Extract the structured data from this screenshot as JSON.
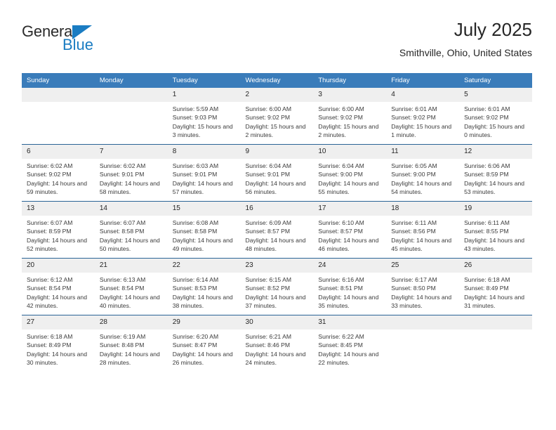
{
  "logo": {
    "word_top": "General",
    "word_bottom": "Blue",
    "triangle_color": "#1a7cc2",
    "top_color": "#2b2b2b"
  },
  "header": {
    "title": "July 2025",
    "subtitle": "Smithville, Ohio, United States"
  },
  "theme": {
    "header_blue": "#3a7cba",
    "row_divider": "#2a6496",
    "daynum_band": "#efefef"
  },
  "calendar": {
    "weekday_headers": [
      "Sunday",
      "Monday",
      "Tuesday",
      "Wednesday",
      "Thursday",
      "Friday",
      "Saturday"
    ],
    "weeks": [
      [
        {
          "day": "",
          "empty": true,
          "sunrise": "",
          "sunset": "",
          "daylight": ""
        },
        {
          "day": "",
          "empty": true,
          "sunrise": "",
          "sunset": "",
          "daylight": ""
        },
        {
          "day": "1",
          "sunrise": "Sunrise: 5:59 AM",
          "sunset": "Sunset: 9:03 PM",
          "daylight": "Daylight: 15 hours and 3 minutes."
        },
        {
          "day": "2",
          "sunrise": "Sunrise: 6:00 AM",
          "sunset": "Sunset: 9:02 PM",
          "daylight": "Daylight: 15 hours and 2 minutes."
        },
        {
          "day": "3",
          "sunrise": "Sunrise: 6:00 AM",
          "sunset": "Sunset: 9:02 PM",
          "daylight": "Daylight: 15 hours and 2 minutes."
        },
        {
          "day": "4",
          "sunrise": "Sunrise: 6:01 AM",
          "sunset": "Sunset: 9:02 PM",
          "daylight": "Daylight: 15 hours and 1 minute."
        },
        {
          "day": "5",
          "sunrise": "Sunrise: 6:01 AM",
          "sunset": "Sunset: 9:02 PM",
          "daylight": "Daylight: 15 hours and 0 minutes."
        }
      ],
      [
        {
          "day": "6",
          "sunrise": "Sunrise: 6:02 AM",
          "sunset": "Sunset: 9:02 PM",
          "daylight": "Daylight: 14 hours and 59 minutes."
        },
        {
          "day": "7",
          "sunrise": "Sunrise: 6:02 AM",
          "sunset": "Sunset: 9:01 PM",
          "daylight": "Daylight: 14 hours and 58 minutes."
        },
        {
          "day": "8",
          "sunrise": "Sunrise: 6:03 AM",
          "sunset": "Sunset: 9:01 PM",
          "daylight": "Daylight: 14 hours and 57 minutes."
        },
        {
          "day": "9",
          "sunrise": "Sunrise: 6:04 AM",
          "sunset": "Sunset: 9:01 PM",
          "daylight": "Daylight: 14 hours and 56 minutes."
        },
        {
          "day": "10",
          "sunrise": "Sunrise: 6:04 AM",
          "sunset": "Sunset: 9:00 PM",
          "daylight": "Daylight: 14 hours and 55 minutes."
        },
        {
          "day": "11",
          "sunrise": "Sunrise: 6:05 AM",
          "sunset": "Sunset: 9:00 PM",
          "daylight": "Daylight: 14 hours and 54 minutes."
        },
        {
          "day": "12",
          "sunrise": "Sunrise: 6:06 AM",
          "sunset": "Sunset: 8:59 PM",
          "daylight": "Daylight: 14 hours and 53 minutes."
        }
      ],
      [
        {
          "day": "13",
          "sunrise": "Sunrise: 6:07 AM",
          "sunset": "Sunset: 8:59 PM",
          "daylight": "Daylight: 14 hours and 52 minutes."
        },
        {
          "day": "14",
          "sunrise": "Sunrise: 6:07 AM",
          "sunset": "Sunset: 8:58 PM",
          "daylight": "Daylight: 14 hours and 50 minutes."
        },
        {
          "day": "15",
          "sunrise": "Sunrise: 6:08 AM",
          "sunset": "Sunset: 8:58 PM",
          "daylight": "Daylight: 14 hours and 49 minutes."
        },
        {
          "day": "16",
          "sunrise": "Sunrise: 6:09 AM",
          "sunset": "Sunset: 8:57 PM",
          "daylight": "Daylight: 14 hours and 48 minutes."
        },
        {
          "day": "17",
          "sunrise": "Sunrise: 6:10 AM",
          "sunset": "Sunset: 8:57 PM",
          "daylight": "Daylight: 14 hours and 46 minutes."
        },
        {
          "day": "18",
          "sunrise": "Sunrise: 6:11 AM",
          "sunset": "Sunset: 8:56 PM",
          "daylight": "Daylight: 14 hours and 45 minutes."
        },
        {
          "day": "19",
          "sunrise": "Sunrise: 6:11 AM",
          "sunset": "Sunset: 8:55 PM",
          "daylight": "Daylight: 14 hours and 43 minutes."
        }
      ],
      [
        {
          "day": "20",
          "sunrise": "Sunrise: 6:12 AM",
          "sunset": "Sunset: 8:54 PM",
          "daylight": "Daylight: 14 hours and 42 minutes."
        },
        {
          "day": "21",
          "sunrise": "Sunrise: 6:13 AM",
          "sunset": "Sunset: 8:54 PM",
          "daylight": "Daylight: 14 hours and 40 minutes."
        },
        {
          "day": "22",
          "sunrise": "Sunrise: 6:14 AM",
          "sunset": "Sunset: 8:53 PM",
          "daylight": "Daylight: 14 hours and 38 minutes."
        },
        {
          "day": "23",
          "sunrise": "Sunrise: 6:15 AM",
          "sunset": "Sunset: 8:52 PM",
          "daylight": "Daylight: 14 hours and 37 minutes."
        },
        {
          "day": "24",
          "sunrise": "Sunrise: 6:16 AM",
          "sunset": "Sunset: 8:51 PM",
          "daylight": "Daylight: 14 hours and 35 minutes."
        },
        {
          "day": "25",
          "sunrise": "Sunrise: 6:17 AM",
          "sunset": "Sunset: 8:50 PM",
          "daylight": "Daylight: 14 hours and 33 minutes."
        },
        {
          "day": "26",
          "sunrise": "Sunrise: 6:18 AM",
          "sunset": "Sunset: 8:49 PM",
          "daylight": "Daylight: 14 hours and 31 minutes."
        }
      ],
      [
        {
          "day": "27",
          "sunrise": "Sunrise: 6:18 AM",
          "sunset": "Sunset: 8:49 PM",
          "daylight": "Daylight: 14 hours and 30 minutes."
        },
        {
          "day": "28",
          "sunrise": "Sunrise: 6:19 AM",
          "sunset": "Sunset: 8:48 PM",
          "daylight": "Daylight: 14 hours and 28 minutes."
        },
        {
          "day": "29",
          "sunrise": "Sunrise: 6:20 AM",
          "sunset": "Sunset: 8:47 PM",
          "daylight": "Daylight: 14 hours and 26 minutes."
        },
        {
          "day": "30",
          "sunrise": "Sunrise: 6:21 AM",
          "sunset": "Sunset: 8:46 PM",
          "daylight": "Daylight: 14 hours and 24 minutes."
        },
        {
          "day": "31",
          "sunrise": "Sunrise: 6:22 AM",
          "sunset": "Sunset: 8:45 PM",
          "daylight": "Daylight: 14 hours and 22 minutes."
        },
        {
          "day": "",
          "empty": true,
          "sunrise": "",
          "sunset": "",
          "daylight": ""
        },
        {
          "day": "",
          "empty": true,
          "sunrise": "",
          "sunset": "",
          "daylight": ""
        }
      ]
    ]
  }
}
